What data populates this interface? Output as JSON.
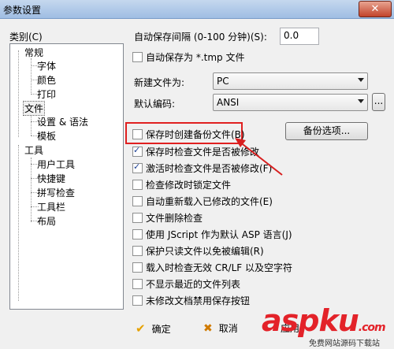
{
  "window": {
    "title": "参数设置",
    "close_label": "✕"
  },
  "category": {
    "label": "类别(C)"
  },
  "tree": {
    "general": "常规",
    "font": "字体",
    "color": "颜色",
    "print": "打印",
    "file": "文件",
    "settings_syntax": "设置 & 语法",
    "template": "模板",
    "tools": "工具",
    "user_tools": "用户工具",
    "shortcuts": "快捷键",
    "spell_check": "拼写检查",
    "toolbar": "工具栏",
    "layout": "布局"
  },
  "autosave": {
    "interval_label": "自动保存间隔 (0-100 分钟)(S):",
    "interval_value": "0.0"
  },
  "autosave_tmp": {
    "label": "自动保存为 *.tmp 文件",
    "checked": false
  },
  "new_file": {
    "label": "新建文件为:",
    "value": "PC"
  },
  "encoding": {
    "label": "默认编码:",
    "value": "ANSI",
    "more_label": "..."
  },
  "backup_options_label": "备份选项...",
  "options": [
    {
      "label": "保存时创建备份文件(B)",
      "checked": false
    },
    {
      "label": "保存时检查文件是否被修改",
      "checked": true
    },
    {
      "label": "激活时检查文件是否被修改(F)",
      "checked": true
    },
    {
      "label": "检查修改时锁定文件",
      "checked": false
    },
    {
      "label": "自动重新载入已修改的文件(E)",
      "checked": false
    },
    {
      "label": "文件删除检查",
      "checked": false
    },
    {
      "label": "使用 JScript 作为默认 ASP 语言(J)",
      "checked": false
    },
    {
      "label": "保护只读文件以免被编辑(R)",
      "checked": false
    },
    {
      "label": "载入时检查无效 CR/LF 以及空字符",
      "checked": false
    },
    {
      "label": "不显示最近的文件列表",
      "checked": false
    },
    {
      "label": "未修改文档禁用保存按钮",
      "checked": false
    }
  ],
  "footer": {
    "ok_label": "确定",
    "cancel_label": "取消",
    "apply_label": "应用"
  },
  "watermark": {
    "brand": "aspku",
    "suffix": ".com",
    "tagline": "免费网站源码下载站"
  },
  "colors": {
    "highlight": "#e02020",
    "arrow": "#d81e1e",
    "title_bar": "#c5d8ee"
  }
}
